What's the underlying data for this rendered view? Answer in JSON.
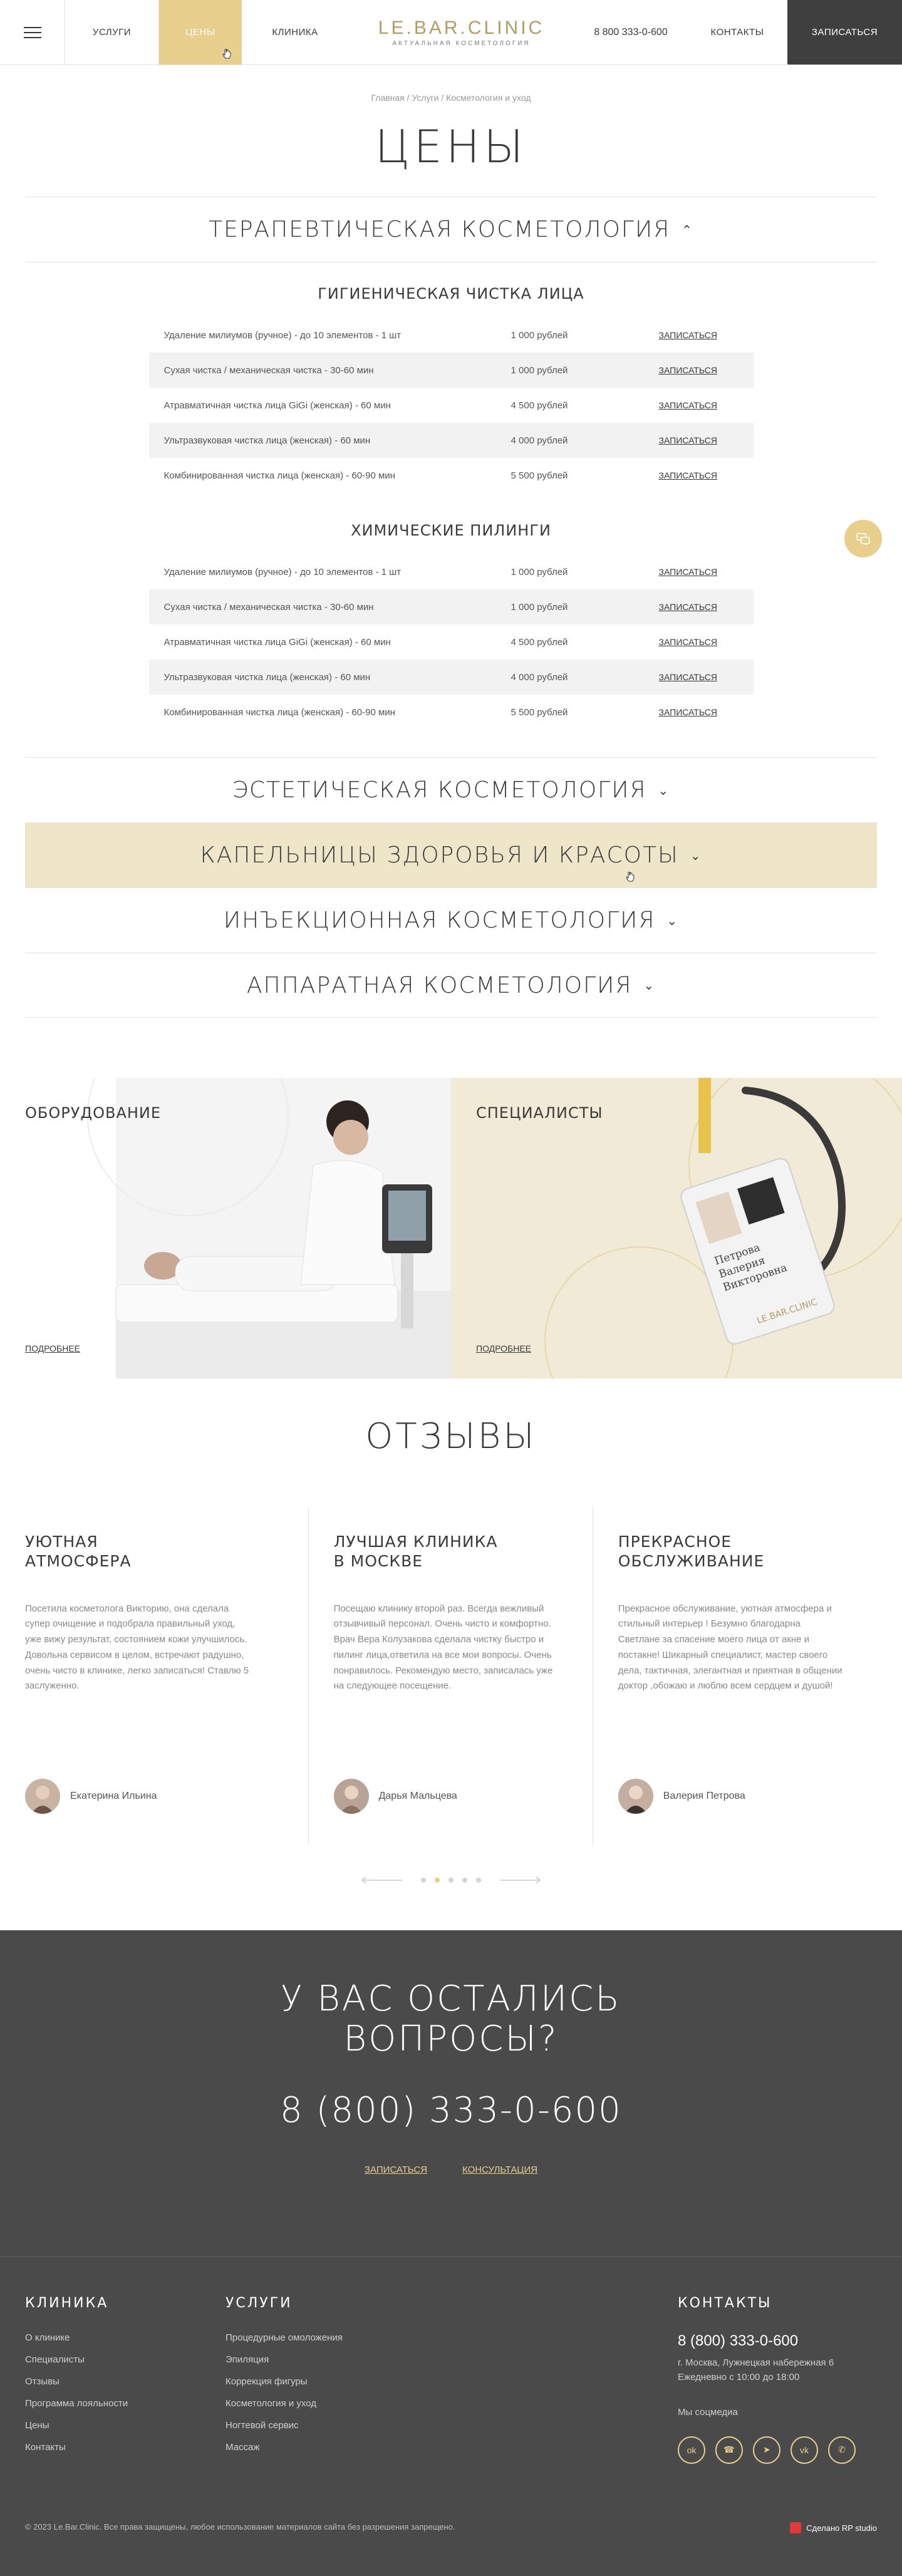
{
  "header": {
    "nav": [
      "Услуги",
      "Цены",
      "Клиника"
    ],
    "logo_main": "LE.BAR.CLINIC",
    "logo_sub": "АКТУАЛЬНАЯ КОСМЕТОЛОГИЯ",
    "phone": "8 800 333-0-600",
    "contacts": "Контакты",
    "signup": "Записаться"
  },
  "breadcrumb": "Главная / Услуги / Косметология и уход",
  "page_title": "ЦЕНЫ",
  "accordion": {
    "open_section": "Терапевтическая косметология",
    "groups": [
      {
        "title": "Гигиеническая чистка лица",
        "rows": [
          {
            "name": "Удаление милиумов (ручное) - до 10 элементов - 1 шт",
            "price": "1 000 рублей",
            "link": "Записаться"
          },
          {
            "name": "Сухая чистка / механическая чистка - 30-60 мин",
            "price": "1 000 рублей",
            "link": "Записаться"
          },
          {
            "name": "Атравматичная чистка лица GiGi (женская) - 60 мин",
            "price": "4 500 рублей",
            "link": "Записаться"
          },
          {
            "name": "Ультразвуковая чистка лица (женская) - 60 мин",
            "price": "4 000 рублей",
            "link": "Записаться"
          },
          {
            "name": "Комбинированная чистка лица (женская) - 60-90 мин",
            "price": "5 500 рублей",
            "link": "Записаться"
          }
        ]
      },
      {
        "title": "Химические пилинги",
        "rows": [
          {
            "name": "Удаление милиумов (ручное) - до 10 элементов - 1 шт",
            "price": "1 000 рублей",
            "link": "Записаться"
          },
          {
            "name": "Сухая чистка / механическая чистка - 30-60 мин",
            "price": "1 000 рублей",
            "link": "Записаться"
          },
          {
            "name": "Атравматичная чистка лица GiGi (женская) - 60 мин",
            "price": "4 500 рублей",
            "link": "Записаться"
          },
          {
            "name": "Ультразвуковая чистка лица (женская) - 60 мин",
            "price": "4 000 рублей",
            "link": "Записаться"
          },
          {
            "name": "Комбинированная чистка лица (женская) - 60-90 мин",
            "price": "5 500 рублей",
            "link": "Записаться"
          }
        ]
      }
    ],
    "closed_sections": [
      "Эстетическая косметология",
      "Капельницы здоровья и красоты",
      "Инъекционная косметология",
      "Аппаратная косметология"
    ]
  },
  "features": {
    "equipment": {
      "title": "Оборудование",
      "link": "Подробнее"
    },
    "specialists": {
      "title": "Специалисты",
      "link": "Подробнее",
      "badge_name": "Петрова Валерия Викторовна"
    }
  },
  "reviews_title": "ОТЗЫВЫ",
  "reviews": [
    {
      "title_1": "Уютная",
      "title_2": "атмосфера",
      "text": "Посетила косметолога Викторию, она сделала супер очищение и подобрала правильный уход, уже вижу результат, состоянием кожи улучшилось. Довольна сервисом в целом, встречают радушно, очень чисто в клинике, легко записаться! Ставлю 5 заслуженно.",
      "author": "Екатерина Ильина"
    },
    {
      "title_1": "Лучшая клиника",
      "title_2": "в Москве",
      "text": "Посещаю клинику второй раз. Всегда вежливый отзывчивый персонал. Очень чисто и комфортно. Врач Вера Колузакова сделала чистку быстро и пилинг лица,ответила на все мои вопросы. Очень понравилось. Рекомендую место, записалась уже на следующее посещение.",
      "author": "Дарья Мальцева"
    },
    {
      "title_1": "Прекрасное",
      "title_2": "обслуживание",
      "text": "Прекрасное обслуживание, уютная атмосфера и стильный интерьер ! Безумно благодарна Светлане за спасение моего лица от акне и постакне! Шикарный специалист, мастер своего дела, тактичная, элегантная и приятная в общении доктор ,обожаю и люблю всем сердцем и душой!",
      "author": "Валерия Петрова"
    }
  ],
  "questions": {
    "title_1": "У вас остались",
    "title_2": "вопросы?",
    "phone": "8 (800) 333-0-600",
    "link_signup": "Записаться",
    "link_consult": "Консультация"
  },
  "footer": {
    "clinic": {
      "title": "Клиника",
      "items": [
        "О клинике",
        "Специалисты",
        "Отзывы",
        "Программа лояльности",
        "Цены",
        "Контакты"
      ]
    },
    "services": {
      "title": "Услуги",
      "items": [
        "Процедурные омоложения",
        "Эпиляция",
        "Коррекция фигуры",
        "Косметология и уход",
        "Ногтевой сервис",
        "Массаж"
      ]
    },
    "contacts": {
      "title": "Контакты",
      "phone": "8 (800) 333-0-600",
      "address": "г. Москва, Лужнецкая набережная 6",
      "hours": "Ежедневно с 10:00 до 18:00",
      "socials_label": "Мы соцмедиа"
    },
    "copyright": "© 2023 Le.Bar.Clinic. Все права защищены, любое использование материалов сайта без разрешения запрещено.",
    "studio": "Сделано RP studio"
  },
  "colors": {
    "accent": "#e8cf8e",
    "dark": "#4a4a4a",
    "hover_row": "#efe6c9"
  }
}
